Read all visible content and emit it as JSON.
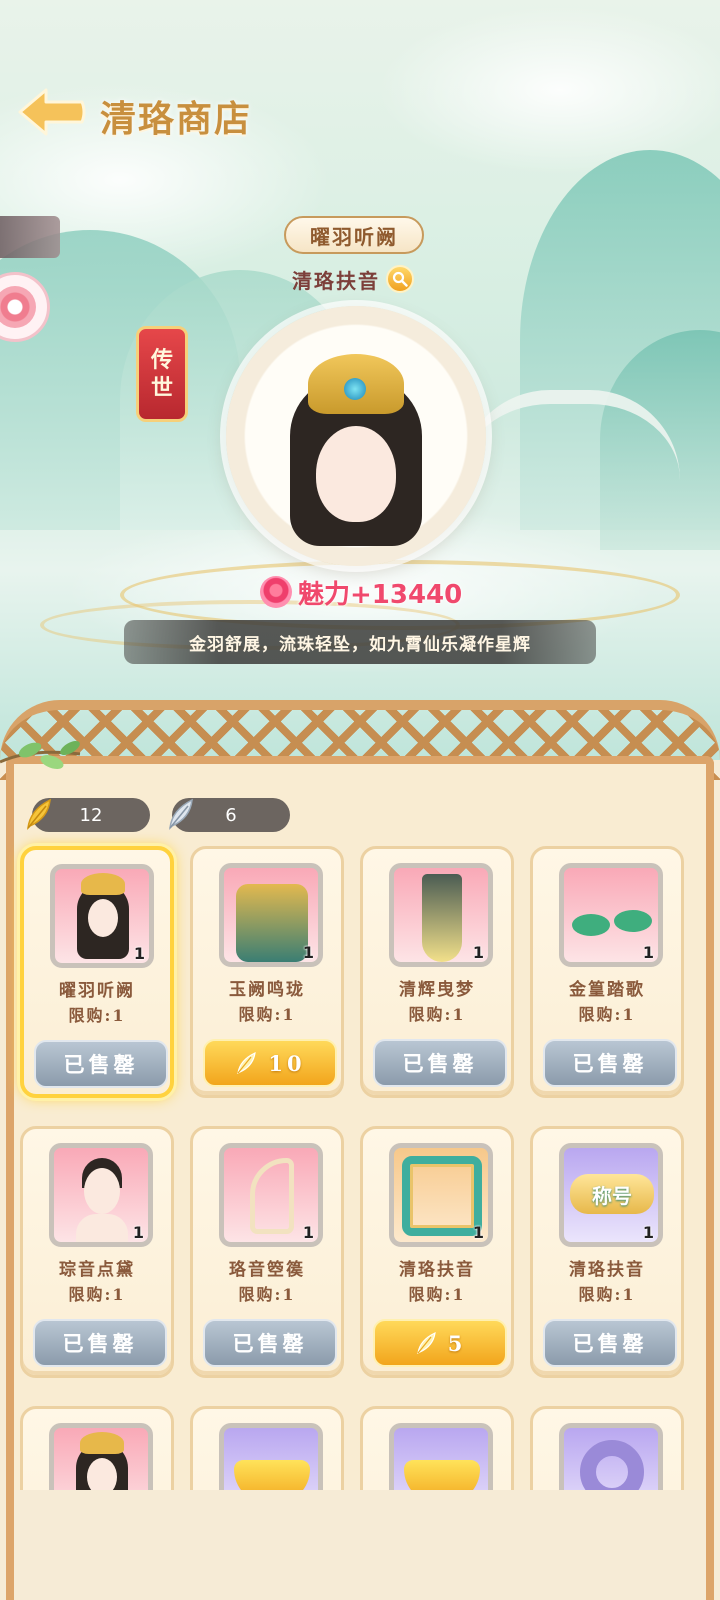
{
  "header": {
    "title": "清珞商店"
  },
  "showcase": {
    "set_name": "曜羽听阙",
    "sub_name": "清珞扶音",
    "rarity": [
      "传",
      "世"
    ],
    "charm_text": "魅力+13440",
    "description": "金羽舒展，流珠轻坠，如九霄仙乐凝作星辉"
  },
  "currencies": [
    {
      "icon": "gold-feather-icon",
      "value": "12"
    },
    {
      "icon": "silver-feather-icon",
      "value": "6"
    }
  ],
  "items": [
    {
      "name": "曜羽听阙",
      "limit": "限购:1",
      "qty": "1",
      "status": "已售罄",
      "price": "",
      "selected": true,
      "bg": "pink",
      "art": "hair"
    },
    {
      "name": "玉阙鸣珑",
      "limit": "限购:1",
      "qty": "1",
      "status": "",
      "price": "10",
      "selected": false,
      "bg": "pink",
      "art": "robe"
    },
    {
      "name": "清辉曳梦",
      "limit": "限购:1",
      "qty": "1",
      "status": "已售罄",
      "price": "",
      "selected": false,
      "bg": "pink",
      "art": "dress"
    },
    {
      "name": "金篁踏歌",
      "limit": "限购:1",
      "qty": "1",
      "status": "已售罄",
      "price": "",
      "selected": false,
      "bg": "pink",
      "art": "shoes"
    },
    {
      "name": "琮音点黛",
      "limit": "限购:1",
      "qty": "1",
      "status": "已售罄",
      "price": "",
      "selected": false,
      "bg": "pink",
      "art": "face"
    },
    {
      "name": "珞音箜篌",
      "limit": "限购:1",
      "qty": "1",
      "status": "已售罄",
      "price": "",
      "selected": false,
      "bg": "pink",
      "art": "harp"
    },
    {
      "name": "清珞扶音",
      "limit": "限购:1",
      "qty": "1",
      "status": "",
      "price": "5",
      "selected": false,
      "bg": "gold",
      "art": "frame"
    },
    {
      "name": "清珞扶音",
      "limit": "限购:1",
      "qty": "1",
      "status": "已售罄",
      "price": "",
      "selected": false,
      "bg": "violet",
      "art": "title",
      "badge_text": "称号"
    },
    {
      "name": "",
      "limit": "",
      "qty": "",
      "status": "",
      "price": "",
      "selected": false,
      "bg": "pink",
      "art": "hair"
    },
    {
      "name": "",
      "limit": "",
      "qty": "",
      "status": "",
      "price": "",
      "selected": false,
      "bg": "violet",
      "art": "ingot"
    },
    {
      "name": "",
      "limit": "",
      "qty": "",
      "status": "",
      "price": "",
      "selected": false,
      "bg": "violet",
      "art": "ingot"
    },
    {
      "name": "",
      "limit": "",
      "qty": "",
      "status": "",
      "price": "",
      "selected": false,
      "bg": "violet",
      "art": "ring"
    }
  ],
  "colors": {
    "accent_gold": "#f2a51c",
    "sold_gray": "#8b9bab",
    "charm_pink": "#f0496d"
  }
}
